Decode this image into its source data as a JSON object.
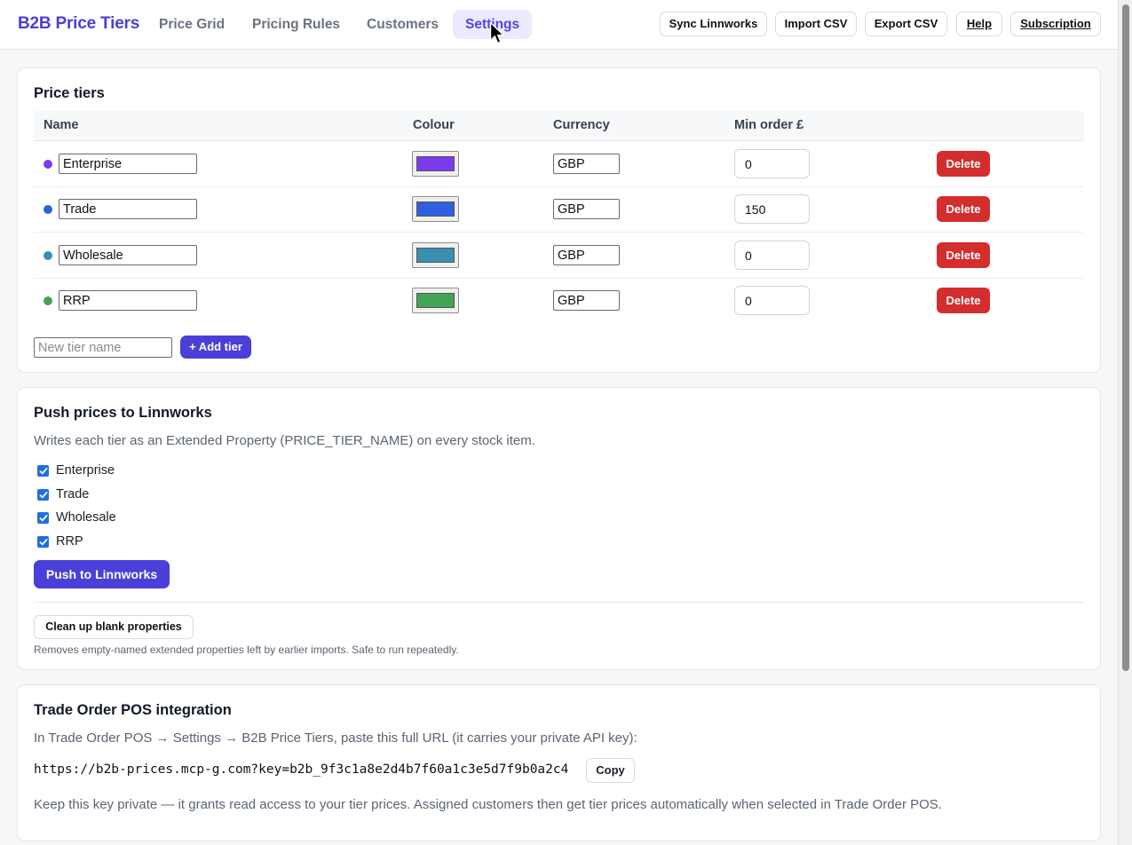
{
  "app": {
    "title": "B2B Price Tiers"
  },
  "nav": {
    "tabs": [
      {
        "label": "Price Grid"
      },
      {
        "label": "Pricing Rules"
      },
      {
        "label": "Customers"
      },
      {
        "label": "Settings",
        "active": true
      }
    ]
  },
  "header_actions": {
    "sync": "Sync Linnworks",
    "import": "Import CSV",
    "export": "Export CSV",
    "help": "Help",
    "subscription": "Subscription"
  },
  "price_tiers": {
    "title": "Price tiers",
    "columns": {
      "name": "Name",
      "colour": "Colour",
      "currency": "Currency",
      "min_order": "Min order £"
    },
    "rows": [
      {
        "name": "Enterprise",
        "color": "#7c3aed",
        "currency": "GBP",
        "min_order": "0",
        "delete_label": "Delete"
      },
      {
        "name": "Trade",
        "color": "#2f5fe0",
        "currency": "GBP",
        "min_order": "150",
        "delete_label": "Delete"
      },
      {
        "name": "Wholesale",
        "color": "#3a8fb0",
        "currency": "GBP",
        "min_order": "0",
        "delete_label": "Delete"
      },
      {
        "name": "RRP",
        "color": "#45a355",
        "currency": "GBP",
        "min_order": "0",
        "delete_label": "Delete"
      }
    ],
    "new_tier_placeholder": "New tier name",
    "add_label": "+ Add tier"
  },
  "push": {
    "title": "Push prices to Linnworks",
    "description": "Writes each tier as an Extended Property (PRICE_TIER_NAME) on every stock item.",
    "checkboxes": [
      {
        "label": "Enterprise",
        "checked": true
      },
      {
        "label": "Trade",
        "checked": true
      },
      {
        "label": "Wholesale",
        "checked": true
      },
      {
        "label": "RRP",
        "checked": true
      }
    ],
    "push_label": "Push to Linnworks",
    "cleanup_label": "Clean up blank properties",
    "cleanup_note": "Removes empty-named extended properties left by earlier imports. Safe to run repeatedly."
  },
  "pos": {
    "title": "Trade Order POS integration",
    "instructions": "In Trade Order POS → Settings → B2B Price Tiers, paste this full URL (it carries your private API key):",
    "url": "https://b2b-prices.mcp-g.com?key=b2b_9f3c1a8e2d4b7f60a1c3e5d7f9b0a2c4",
    "copy_label": "Copy",
    "note": "Keep this key private — it grants read access to your tier prices. Assigned customers then get tier prices automatically when selected in Trade Order POS."
  },
  "colors": {
    "brand": "#4a3fd8",
    "danger": "#d42d2d",
    "checkbox": "#1f6fe0"
  }
}
